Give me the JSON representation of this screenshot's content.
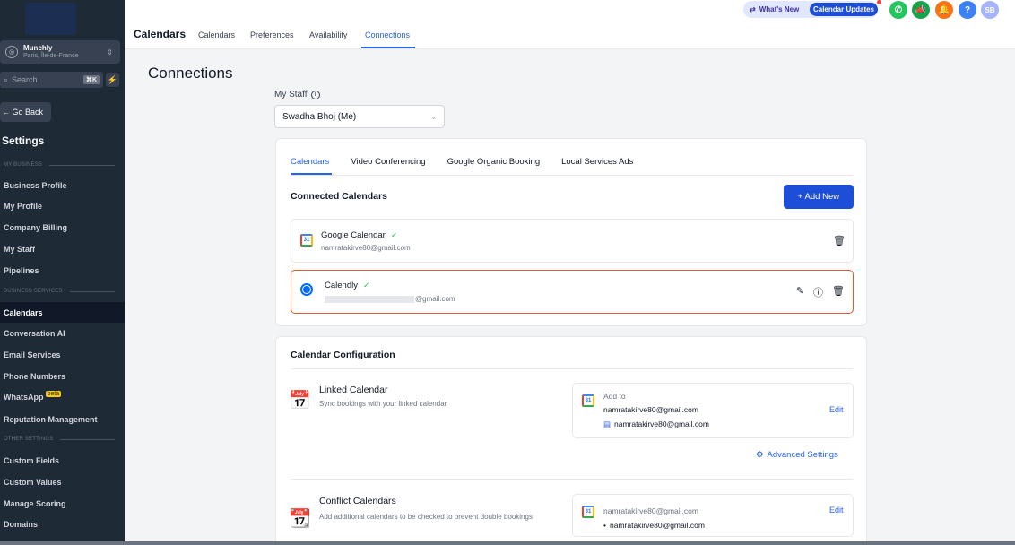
{
  "sidebar": {
    "location": {
      "name": "Munchly",
      "sub": "Paris, Île-de-France"
    },
    "search": {
      "placeholder": "Search",
      "shortcut": "⌘K"
    },
    "go_back": "← Go Back",
    "title": "Settings",
    "sections": {
      "my_business": "MY BUSINESS",
      "business_services": "BUSINESS SERVICES",
      "other_settings": "OTHER SETTINGS"
    },
    "items": [
      {
        "label": "Business Profile"
      },
      {
        "label": "My Profile"
      },
      {
        "label": "Company Billing"
      },
      {
        "label": "My Staff"
      },
      {
        "label": "Pipelines"
      },
      {
        "label": "Calendars"
      },
      {
        "label": "Conversation AI"
      },
      {
        "label": "Email Services"
      },
      {
        "label": "Phone Numbers"
      },
      {
        "label": "WhatsApp"
      },
      {
        "label": "Reputation Management"
      },
      {
        "label": "Custom Fields"
      },
      {
        "label": "Custom Values"
      },
      {
        "label": "Manage Scoring"
      },
      {
        "label": "Domains"
      }
    ],
    "beta_badge": "beta"
  },
  "topbar": {
    "title": "Calendars",
    "tabs": [
      "Calendars",
      "Preferences",
      "Availability",
      "Connections"
    ],
    "whats_new": "What's New",
    "calendar_updates": "Calendar Updates",
    "avatar_initials": "SB",
    "help": "?"
  },
  "main": {
    "page_title": "Connections",
    "my_staff_label": "My Staff",
    "staff_selected": "Swadha Bhoj (Me)",
    "tabs": [
      "Calendars",
      "Video Conferencing",
      "Google Organic Booking",
      "Local Services Ads"
    ],
    "connected_calendars_title": "Connected Calendars",
    "add_new": "+ Add New",
    "connected": [
      {
        "name": "Google Calendar",
        "email": "namratakirve80@gmail.com"
      },
      {
        "name": "Calendly",
        "email": "@gmail.com"
      }
    ],
    "config_title": "Calendar Configuration",
    "linked": {
      "title": "Linked Calendar",
      "subtitle": "Sync bookings with your linked calendar",
      "add_to": "Add to",
      "account": "namratakirve80@gmail.com",
      "calendar": "namratakirve80@gmail.com",
      "edit": "Edit"
    },
    "advanced_settings": "Advanced Settings",
    "conflict": {
      "title": "Conflict Calendars",
      "subtitle": "Add additional calendars to be checked to prevent double bookings",
      "account": "namratakirve80@gmail.com",
      "calendar": "namratakirve80@gmail.com",
      "edit": "Edit"
    }
  },
  "colors": {
    "sidebar_bg": "#1f2a37",
    "accent": "#2563eb",
    "selected_border": "#e0582f",
    "success": "#22c55e"
  }
}
